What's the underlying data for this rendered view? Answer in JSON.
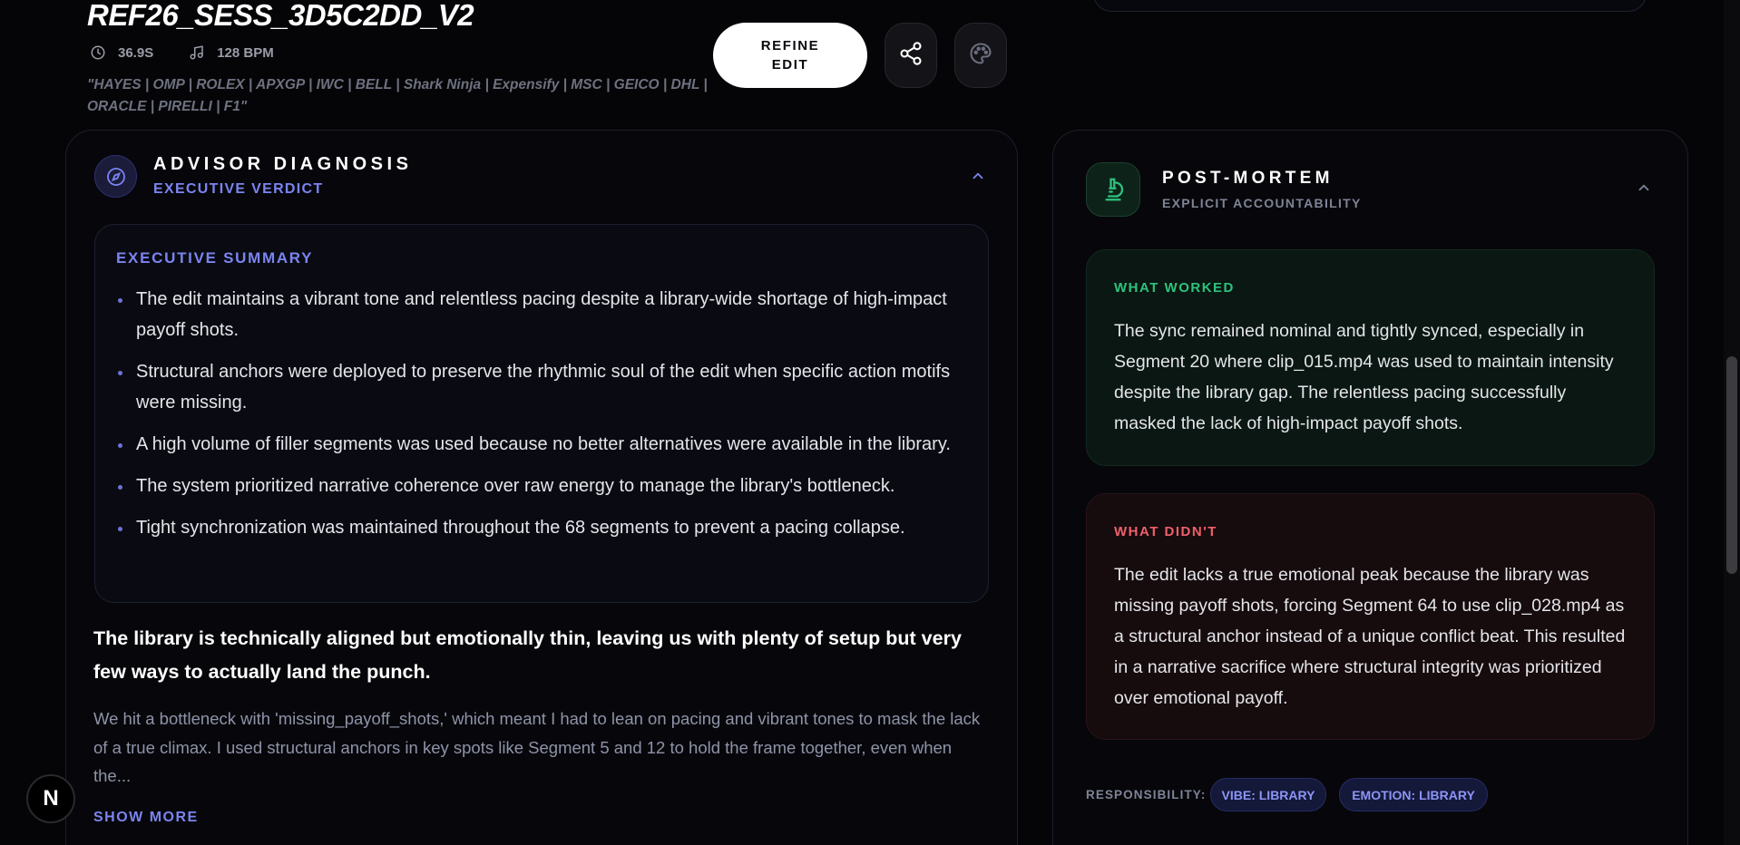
{
  "header": {
    "title": "REF26_SESS_3D5C2DD_V2",
    "duration": "36.9S",
    "bpm": "128 BPM",
    "tags": "\"HAYES | OMP | ROLEX | APXGP | IWC | BELL | Shark Ninja | Expensify | MSC | GEICO | DHL | ORACLE | PIRELLI | F1\"",
    "refine_line1": "REFINE",
    "refine_line2": "EDIT"
  },
  "advisor": {
    "title": "ADVISOR DIAGNOSIS",
    "subtitle": "EXECUTIVE VERDICT",
    "summary_title": "EXECUTIVE SUMMARY",
    "bullets": [
      "The edit maintains a vibrant tone and relentless pacing despite a library-wide shortage of high-impact payoff shots.",
      "Structural anchors were deployed to preserve the rhythmic soul of the edit when specific action motifs were missing.",
      "A high volume of filler segments was used because no better alternatives were available in the library.",
      "The system prioritized narrative coherence over raw energy to manage the library's bottleneck.",
      "Tight synchronization was maintained throughout the 68 segments to prevent a pacing collapse."
    ],
    "headline": "The library is technically aligned but emotionally thin, leaving us with plenty of setup but very few ways to actually land the punch.",
    "body": "We hit a bottleneck with 'missing_payoff_shots,' which meant I had to lean on pacing and vibrant tones to mask the lack of a true climax. I used structural anchors in key spots like Segment 5 and 12 to hold the frame together, even when the...",
    "show_more": "SHOW MORE"
  },
  "postmortem": {
    "title": "POST-MORTEM",
    "subtitle": "EXPLICIT ACCOUNTABILITY",
    "worked_label": "WHAT WORKED",
    "worked_text": "The sync remained nominal and tightly synced, especially in Segment 20 where clip_015.mp4 was used to maintain intensity despite the library gap. The relentless pacing successfully masked the lack of high-impact payoff shots.",
    "didnt_label": "WHAT DIDN'T",
    "didnt_text": "The edit lacks a true emotional peak because the library was missing payoff shots, forcing Segment 64 to use clip_028.mp4 as a structural anchor instead of a unique conflict beat. This resulted in a narrative sacrifice where structural integrity was prioritized over emotional payoff.",
    "responsibility_label": "RESPONSIBILITY:",
    "pills": [
      "VIBE: LIBRARY",
      "EMOTION: LIBRARY"
    ]
  },
  "misc": {
    "logo_letter": "N"
  },
  "icons": {
    "duration": "clock-icon",
    "bpm": "music-note-icon",
    "share": "share-icon",
    "theme": "palette-icon",
    "advisor": "compass-icon",
    "postmortem": "microscope-icon"
  },
  "colors": {
    "accent": "#7b84f0",
    "worked": "#2ec27e",
    "didnt": "#f0606b",
    "background": "#050507"
  }
}
